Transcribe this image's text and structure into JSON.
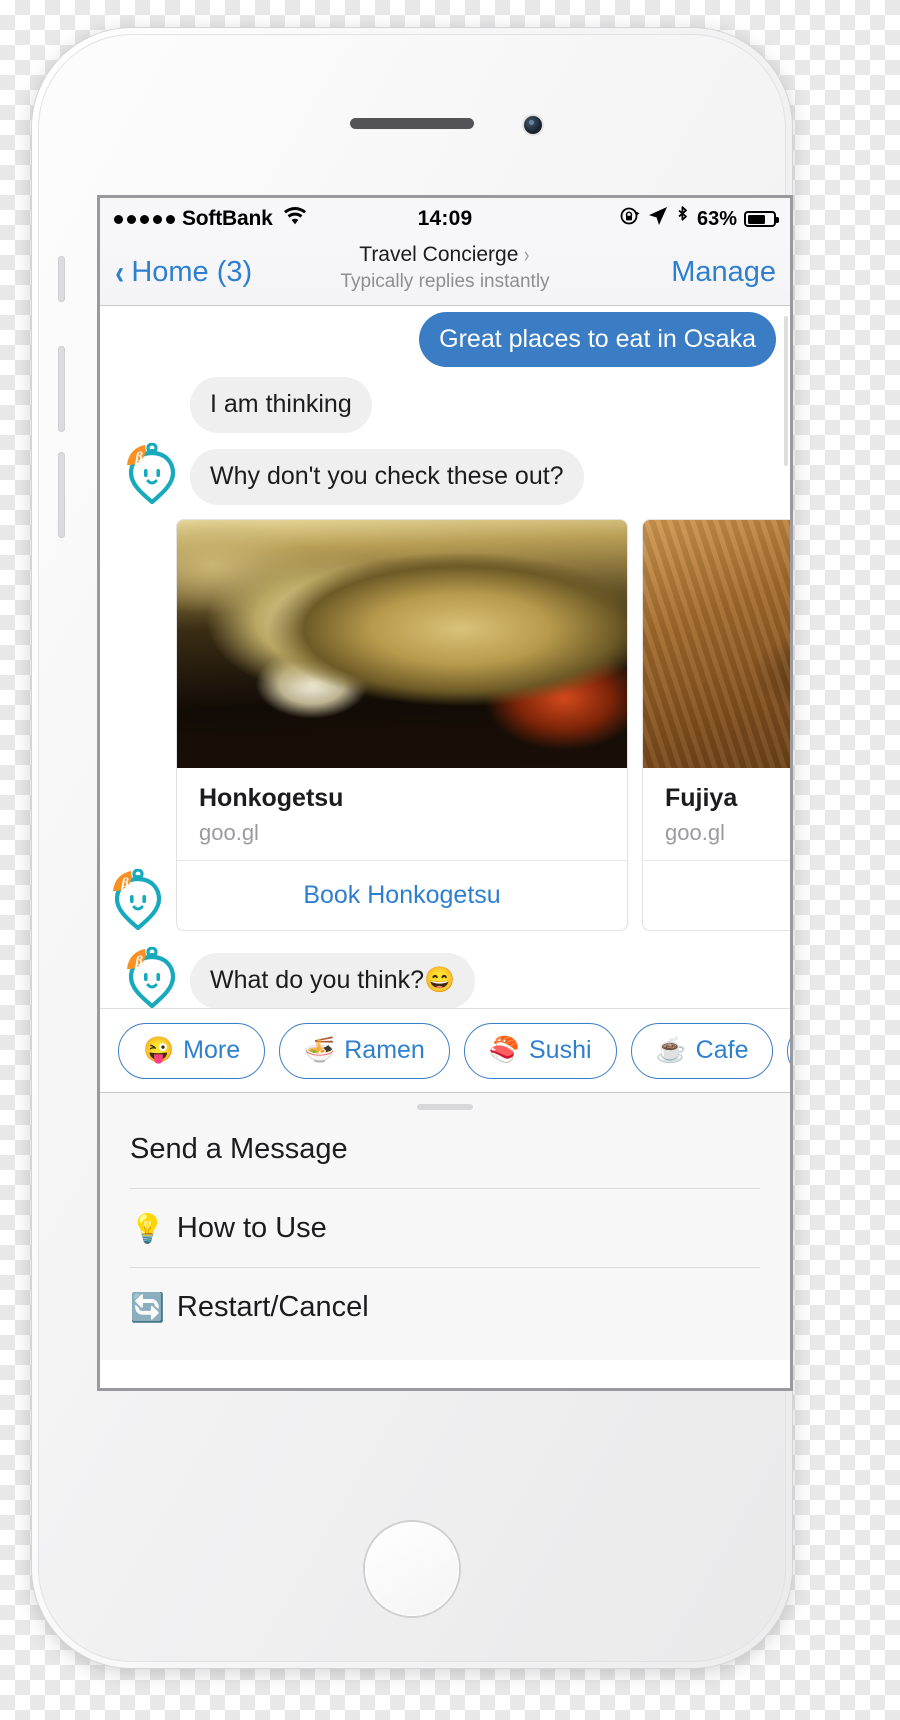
{
  "status_bar": {
    "carrier": "SoftBank",
    "signal_dots": 5,
    "wifi_icon": "wifi-icon",
    "time": "14:09",
    "icons": [
      "rotation-lock-icon",
      "location-arrow-icon",
      "bluetooth-icon"
    ],
    "battery_percent": "63%",
    "battery_level": 63
  },
  "nav_bar": {
    "back_label": "Home (3)",
    "back_icon": "chevron-left-icon",
    "title": "Travel Concierge",
    "title_chevron": "chevron-right-icon",
    "subtitle": "Typically replies instantly",
    "right_action": "Manage"
  },
  "colors": {
    "accent_blue": "#2f7fd1",
    "outgoing_bubble": "#3b7dc4",
    "incoming_bubble": "#efefef",
    "bot_teal": "#17a9bd",
    "bot_orange": "#f79123"
  },
  "messages": [
    {
      "from": "user",
      "text": "Great places to eat in Osaka",
      "avatar": null
    },
    {
      "from": "bot",
      "text": "I am thinking",
      "avatar": null
    },
    {
      "from": "bot",
      "text": "Why don't you check these out?",
      "avatar": "bot-avatar-icon"
    },
    {
      "from": "bot",
      "text": "What do you think?😄",
      "avatar": "bot-avatar-icon"
    }
  ],
  "cards": [
    {
      "title": "Honkogetsu",
      "subtitle": "goo.gl",
      "button_label": "Book Honkogetsu",
      "image_name": "japanese-lidded-bowl-photo"
    },
    {
      "title": "Fujiya",
      "subtitle": "goo.gl",
      "button_label": "",
      "image_name": "wooden-board-photo"
    }
  ],
  "quick_replies": [
    {
      "emoji": "😜",
      "label": "More"
    },
    {
      "emoji": "🍜",
      "label": "Ramen"
    },
    {
      "emoji": "🍣",
      "label": "Sushi"
    },
    {
      "emoji": "☕",
      "label": "Cafe"
    },
    {
      "emoji": "🍷",
      "label": ""
    }
  ],
  "menu": {
    "grabber": "drag-handle",
    "items": [
      {
        "emoji": "",
        "label": "Send a Message"
      },
      {
        "emoji": "💡",
        "label": "How to Use"
      },
      {
        "emoji": "🔄",
        "label": "Restart/Cancel"
      }
    ]
  }
}
